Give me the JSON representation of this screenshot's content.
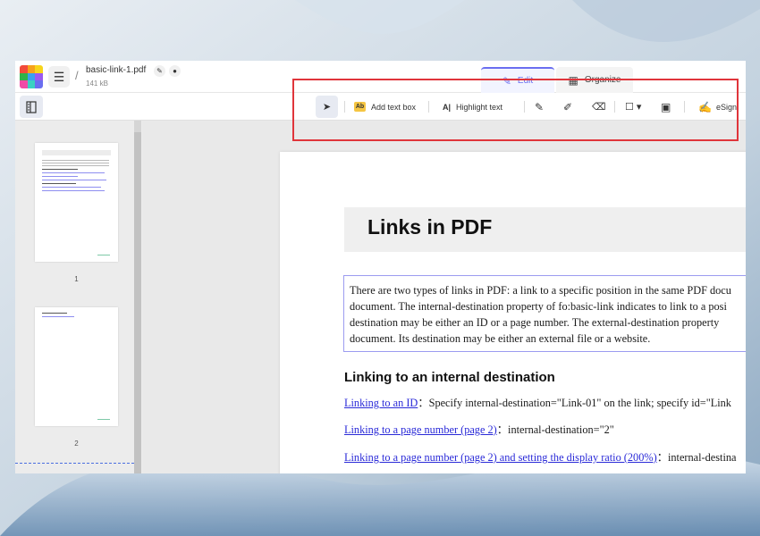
{
  "app": {
    "file_name": "basic-link-1.pdf",
    "file_size": "141 kB",
    "path_separator": "/",
    "menu_glyph": "☰",
    "rename_glyph": "✎",
    "lock_glyph": "🔒"
  },
  "tabs": [
    {
      "label": "Edit",
      "icon": "pencil-icon",
      "glyph": "✎",
      "active": true
    },
    {
      "label": "Organize",
      "icon": "grid-icon",
      "glyph": "▦",
      "active": false
    }
  ],
  "toolbar": {
    "select_glyph": "➤",
    "add_text_box": "Add text box",
    "add_text_badge": "Ab",
    "highlight_text": "Highlight text",
    "highlight_badge": "A|",
    "pen_glyph": "✎",
    "highlighter_glyph": "✐",
    "eraser_glyph": "⌫",
    "shape_glyph": "☐ ▾",
    "image_glyph": "▣",
    "esign_glyph": "✍",
    "esign": "eSign"
  },
  "thumbnails": [
    {
      "label": "1"
    },
    {
      "label": "2"
    }
  ],
  "document": {
    "title": "Links in PDF",
    "intro_lines": [
      "There are two types of links in PDF: a link to a specific position in the same PDF docu",
      "document. The internal-destination property of fo:basic-link indicates to link to a posi",
      "destination may be either an ID or a page number. The external-destination property",
      "document. Its destination may be either an external file or a website."
    ],
    "section_heading": "Linking to an internal destination",
    "links": [
      {
        "link_text": "Linking to an ID",
        "rest": "：Specify internal-destination=\"Link-01\" on the link; specify id=\"Link"
      },
      {
        "link_text": "Linking to a page number (page 2)",
        "rest": "：internal-destination=\"2\""
      },
      {
        "link_text": "Linking to a page number (page 2) and setting the display ratio (200%)",
        "rest": "：internal-destina"
      }
    ]
  },
  "colors": {
    "accent": "#6a6ef0",
    "annotation": "#e0353b",
    "link": "#2a2ad8"
  }
}
